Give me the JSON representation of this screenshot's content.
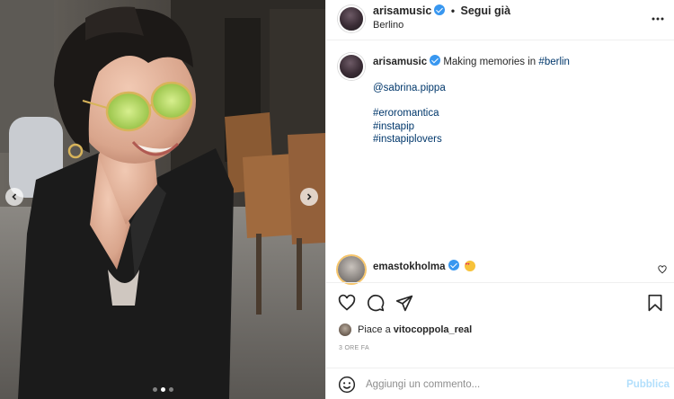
{
  "post": {
    "username": "arisamusic",
    "follow_separator": "•",
    "follow_label": "Segui già",
    "location": "Berlino",
    "more_icon": "more-horizontal-icon",
    "photo": {
      "carousel_dots": 3,
      "active_dot": 1
    }
  },
  "caption": {
    "username": "arisamusic",
    "text": "Making memories in",
    "hashtag_inline": "#berlin",
    "mention": "@sabrina.pippa",
    "hashtags": [
      "#eroromantica",
      "#instapip",
      "#instapiplovers"
    ]
  },
  "comment": {
    "username": "emastokholma",
    "emoji_icon": "heart-eyes-emoji-icon"
  },
  "actions": {
    "like_icon": "heart-icon",
    "comment_icon": "comment-icon",
    "share_icon": "share-icon",
    "save_icon": "bookmark-icon"
  },
  "likes": {
    "prefix": "Piace a",
    "user": "vitocoppola_real"
  },
  "timestamp": "3 ORE FA",
  "add_comment": {
    "placeholder": "Aggiungi un commento...",
    "publish_label": "Pubblica"
  },
  "colors": {
    "verified": "#3897f0",
    "link": "#00376b",
    "publish_disabled": "#b2dffc",
    "border": "#efefef"
  }
}
